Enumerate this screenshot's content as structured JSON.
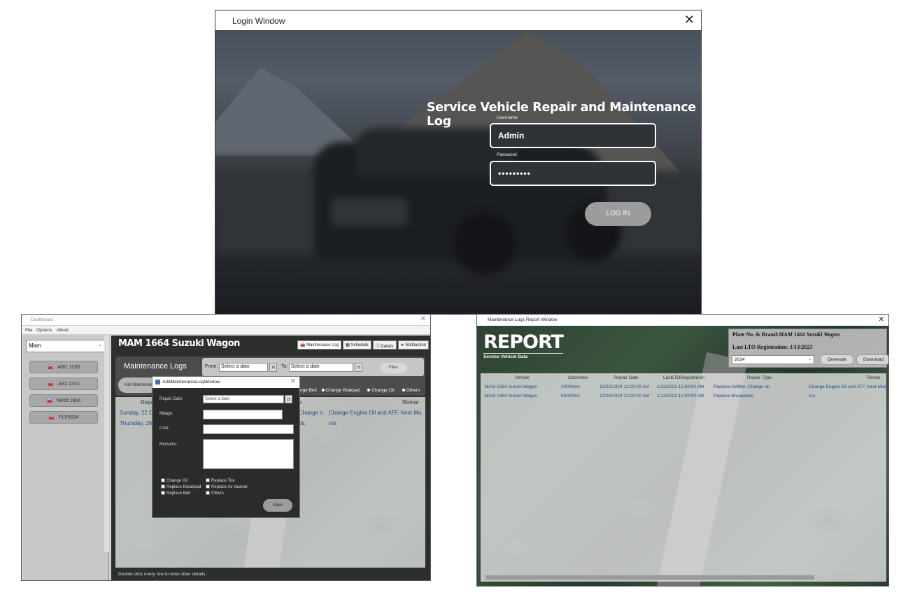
{
  "login": {
    "title": "Login Window",
    "close": "✕",
    "heading": "Service Vehicle Repair and Maintenance Log",
    "username_label": "Username",
    "username_value": "Admin",
    "password_label": "Password:",
    "password_value": "•••••••••",
    "login_button": "LOG IN"
  },
  "dashboard": {
    "title": "Dashboard",
    "close": "✕",
    "menu": [
      "File",
      "Options",
      "About"
    ],
    "search_value": "Mam",
    "vehicles": [
      "ABC 1235",
      "AS2 2332",
      "MAM 1664",
      "PLP5894"
    ],
    "selected_title": "MAM 1664 Suzuki Wagon",
    "tabs": [
      "Maintenance Log",
      "Schedule",
      "Details",
      "Notifiaction"
    ],
    "panel_title": "Maintenance Logs",
    "add_button": "Add Maintenance Log",
    "from_label": "From:",
    "to_label": "To:",
    "from_placeholder": "Select a date",
    "to_placeholder": "Select a date",
    "calendar": "15",
    "filter_button": "Filter",
    "radio_options": [
      "nge Belt",
      "Change Brakpad",
      "Change Oil",
      "Others"
    ],
    "grid_header_repair": "Repa",
    "grid_header_type": "pe",
    "grid_header_remarks": "Remar",
    "rows": [
      {
        "date": "Sunday, 22 D",
        "type": "Change o",
        "remarks": "Change Engine Oil and ATF, Next Ma"
      },
      {
        "date": "Thursday, 26",
        "type": "ds,",
        "remarks": "n/a"
      }
    ],
    "hint": "Double click every row to view other details."
  },
  "add_dialog": {
    "title": "AddMaintenanceLogWindow",
    "close": "✕",
    "repair_date_label": "Repair Date:",
    "repair_date_placeholder": "Select a date",
    "calendar": "15",
    "milage_label": "Milage:",
    "cost_label": "Cost:",
    "remarks_label": "Remarks:",
    "checkboxes_left": [
      "Change Oil",
      "Replace Breakpad",
      "Replace Belt"
    ],
    "checkboxes_right": [
      "Replace Tire",
      "Replace Air cleaner",
      "Others"
    ],
    "save_button": "Save"
  },
  "report": {
    "title": "Maintenance Logs Report Window",
    "close": "✕",
    "big_title": "REPORT",
    "subtitle": "Service Vehicle Data",
    "plate_label": "Plate No. & Brand:",
    "plate_value": "MAM 1664 Suzuki Wagon",
    "lto_label": "Last LTO Registration:",
    "lto_value": "1/13/2023",
    "year_value": "2024",
    "generate_button": "Generate",
    "download_button": "Download",
    "columns": [
      "Vehicle",
      "Odometer",
      "Repair Date",
      "LastLTORegistration",
      "Repair Type",
      "Remar"
    ],
    "rows": [
      [
        "MAM 1664 Suzuki Wagon",
        "30000km",
        "12/22/2024 12:00:00 AM",
        "1/13/2023 12:00:00 AM",
        "Replace Airfilter, Change oil,",
        "Change Engine Oil and ATF, Next Main"
      ],
      [
        "MAM 1664 Suzuki Wagon",
        "50000km",
        "12/26/2024 12:00:00 AM",
        "1/13/2023 12:00:00 AM",
        "Replace Breakpads,",
        "n/a"
      ]
    ]
  },
  "colors": {
    "grid_text": "#244a88",
    "veil": "#e2e2e2",
    "button_gray": "#9c9c9c"
  }
}
